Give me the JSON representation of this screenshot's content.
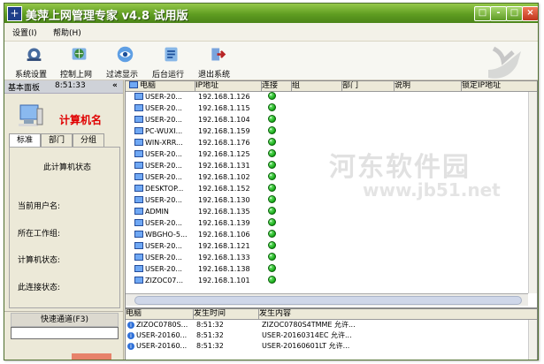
{
  "window": {
    "title": "美萍上网管理专家 v4.8 试用版",
    "controls": [
      "□",
      "-",
      "□",
      "×"
    ]
  },
  "menu": [
    {
      "label": "设置(I)"
    },
    {
      "label": "帮助(H)"
    }
  ],
  "toolbar": [
    {
      "label": "系统设置",
      "icon": "system-settings-icon"
    },
    {
      "label": "控制上网",
      "icon": "internet-control-icon"
    },
    {
      "label": "过滤显示",
      "icon": "filter-display-icon"
    },
    {
      "label": "后台运行",
      "icon": "background-run-icon"
    },
    {
      "label": "退出系统",
      "icon": "exit-system-icon"
    }
  ],
  "sidebar": {
    "title": "基本面板",
    "time": "8:51:33",
    "collapse": "«",
    "computer_label": "计算机名",
    "tabs": [
      "标准",
      "部门",
      "分组"
    ],
    "status_title": "此计算机状态",
    "fields": [
      "当前用户名:",
      "所在工作组:",
      "计算机状态:",
      "此连接状态:"
    ],
    "quick_channel": "快速通道(F3)",
    "quick_input": ""
  },
  "main": {
    "columns": [
      "电脑",
      "IP地址",
      "连接",
      "组",
      "部门",
      "说明",
      "锁定IP地址"
    ],
    "rows": [
      {
        "computer": "USER-20...",
        "ip": "192.168.1.126"
      },
      {
        "computer": "USER-20...",
        "ip": "192.168.1.115"
      },
      {
        "computer": "USER-20...",
        "ip": "192.168.1.104"
      },
      {
        "computer": "PC-WUXI...",
        "ip": "192.168.1.159"
      },
      {
        "computer": "WIN-XRR...",
        "ip": "192.168.1.176"
      },
      {
        "computer": "USER-20...",
        "ip": "192.168.1.125"
      },
      {
        "computer": "USER-20...",
        "ip": "192.168.1.131"
      },
      {
        "computer": "USER-20...",
        "ip": "192.168.1.102"
      },
      {
        "computer": "DESKTOP...",
        "ip": "192.168.1.152"
      },
      {
        "computer": "USER-20...",
        "ip": "192.168.1.130"
      },
      {
        "computer": "ADMIN",
        "ip": "192.168.1.135"
      },
      {
        "computer": "USER-20...",
        "ip": "192.168.1.139"
      },
      {
        "computer": "WBGHO-5...",
        "ip": "192.168.1.106"
      },
      {
        "computer": "USER-20...",
        "ip": "192.168.1.121"
      },
      {
        "computer": "USER-20...",
        "ip": "192.168.1.133"
      },
      {
        "computer": "USER-20...",
        "ip": "192.168.1.138"
      },
      {
        "computer": "ZIZOC07...",
        "ip": "192.168.1.101"
      }
    ]
  },
  "watermark": {
    "primary": "河东软件园",
    "secondary": "www.jb51.net"
  },
  "log": {
    "columns": [
      "电脑",
      "发生时间",
      "发生内容"
    ],
    "rows": [
      {
        "computer": "ZIZOC0780S...",
        "time": "8:51:32",
        "content": "ZIZOC0780S4TMME 允许..."
      },
      {
        "computer": "USER-20160...",
        "time": "8:51:32",
        "content": "USER-20160314EC 允许..."
      },
      {
        "computer": "USER-20160...",
        "time": "8:51:32",
        "content": "USER-20160601LT 允许..."
      }
    ]
  }
}
